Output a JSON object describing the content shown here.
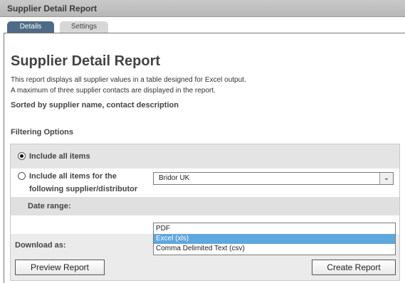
{
  "window": {
    "title": "Supplier Detail Report"
  },
  "tabs": [
    {
      "label": "Details",
      "active": true
    },
    {
      "label": "Settings",
      "active": false
    }
  ],
  "main": {
    "heading": "Supplier Detail Report",
    "description_line1": "This report displays all supplier values in a table designed for Excel output.",
    "description_line2": "A maximum of three supplier contacts are displayed in the report.",
    "sorted_by": "Sorted by supplier name, contact description",
    "filtering_label": "Filtering Options"
  },
  "filter": {
    "option_all": "Include all items",
    "option_supplier_line1": "Include all items for the",
    "option_supplier_line2": "following supplier/distributor",
    "selected_option": "Include all items",
    "supplier_value": "Bridor UK",
    "date_range_label": "Date range:"
  },
  "download": {
    "label": "Download as:",
    "options": [
      "PDF",
      "Excel (xls)",
      "Comma Delimited Text (csv)"
    ],
    "selected": "Excel (xls)"
  },
  "buttons": {
    "preview": "Preview Report",
    "create": "Create Report"
  },
  "colors": {
    "active_tab": "#4e6a86",
    "selected_option": "#5fa7dd",
    "titlebar": "#c0c0c0"
  }
}
